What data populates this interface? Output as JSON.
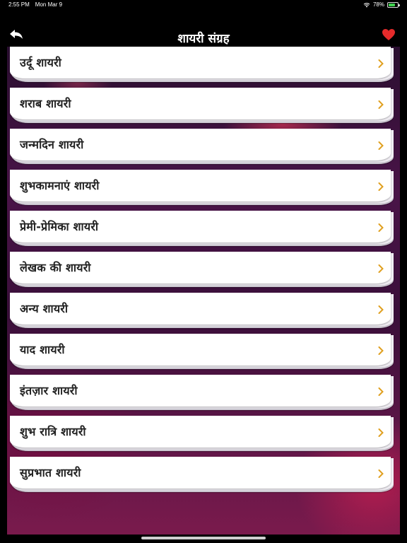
{
  "status_bar": {
    "time": "2:55 PM",
    "date": "Mon Mar 9",
    "battery": "78%",
    "battery_level": 0.78
  },
  "nav": {
    "title": "शायरी संग्रह",
    "back_icon": "back-arrow-icon",
    "favorites_icon": "heart-icon",
    "heart_color": "#e52b2b"
  },
  "categories": [
    {
      "label": "उर्दू शायरी"
    },
    {
      "label": "शराब शायरी"
    },
    {
      "label": "जन्मदिन शायरी"
    },
    {
      "label": "शुभकामनाएं शायरी"
    },
    {
      "label": "प्रेमी-प्रेमिका शायरी"
    },
    {
      "label": "लेखक की शायरी"
    },
    {
      "label": "अन्य शायरी"
    },
    {
      "label": "याद शायरी"
    },
    {
      "label": "इंतज़ार शायरी"
    },
    {
      "label": "शुभ रात्रि शायरी"
    },
    {
      "label": "सुप्रभात शायरी"
    }
  ],
  "colors": {
    "chevron": "#e0a020"
  }
}
